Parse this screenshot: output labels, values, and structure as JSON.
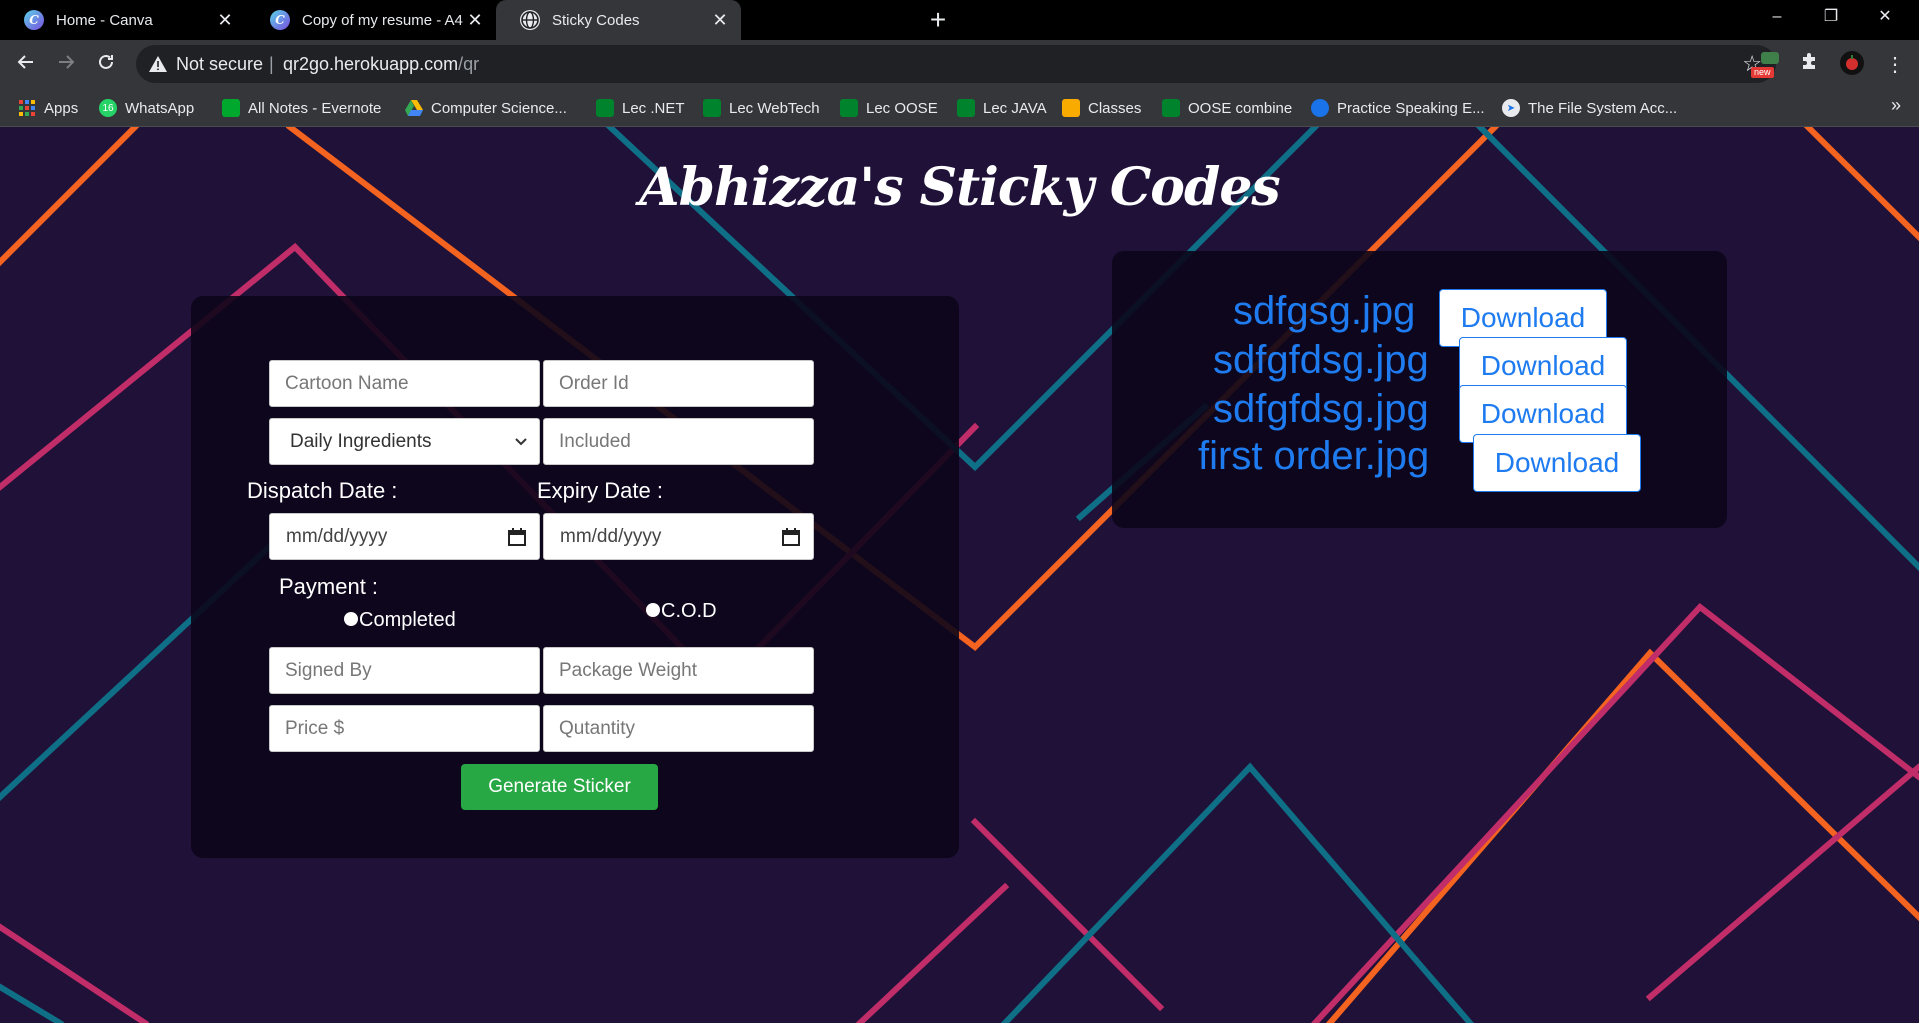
{
  "browser": {
    "tabs": [
      {
        "title": "Home - Canva",
        "favicon": "canva-icon"
      },
      {
        "title": "Copy of my resume - A4",
        "favicon": "canva-icon"
      },
      {
        "title": "Sticky Codes",
        "favicon": "globe-icon"
      }
    ],
    "new_tab_label": "+",
    "window_controls": {
      "minimize": "–",
      "maximize": "❐",
      "close": "✕"
    },
    "security_label": "Not secure",
    "url_host": "qr2go.herokuapp.com",
    "url_path": "/qr",
    "extension_badge": "new",
    "bookmarks": [
      {
        "label": "Apps",
        "icon": "apps-grid-icon"
      },
      {
        "label": "WhatsApp",
        "icon": "whatsapp-icon",
        "badge": "16"
      },
      {
        "label": "All Notes - Evernote",
        "icon": "evernote-icon"
      },
      {
        "label": "Computer Science...",
        "icon": "google-drive-icon"
      },
      {
        "label": "Lec .NET",
        "icon": "meet-icon"
      },
      {
        "label": "Lec WebTech",
        "icon": "meet-icon"
      },
      {
        "label": "Lec OOSE",
        "icon": "meet-icon"
      },
      {
        "label": "Lec JAVA",
        "icon": "meet-icon"
      },
      {
        "label": "Classes",
        "icon": "classroom-icon"
      },
      {
        "label": "OOSE combine",
        "icon": "meet-icon"
      },
      {
        "label": "Practice Speaking E...",
        "icon": "circle-icon"
      },
      {
        "label": "The File System Acc...",
        "icon": "paper-plane-icon"
      }
    ],
    "bookmarks_overflow": "»"
  },
  "site": {
    "title": "Abhizza's Sticky Codes"
  },
  "form": {
    "cartoon_name_placeholder": "Cartoon Name",
    "order_id_placeholder": "Order Id",
    "category_selected": "Daily Ingredients",
    "included_placeholder": "Included",
    "dispatch_label": "Dispatch Date :",
    "expiry_label": "Expiry Date :",
    "date_placeholder": "mm/dd/yyyy",
    "payment_label": "Payment :",
    "payment_options": [
      "Completed",
      "C.O.D"
    ],
    "signed_by_placeholder": "Signed By",
    "weight_placeholder": "Package Weight",
    "price_placeholder": "Price $",
    "quantity_placeholder": "Qutantity",
    "submit_label": "Generate Sticker"
  },
  "files": {
    "download_label": "Download",
    "items": [
      "sdfgsg.jpg",
      "sdfgfdsg.jpg",
      "sdfgfdsg.jpg",
      "first order.jpg"
    ]
  },
  "colors": {
    "page_bg": "#1f1138",
    "accent_blue": "#1e7bf0",
    "button_green": "#28a745",
    "line_orange": "#f4631f",
    "line_teal": "#0f6f86",
    "line_pink": "#c02d68"
  }
}
